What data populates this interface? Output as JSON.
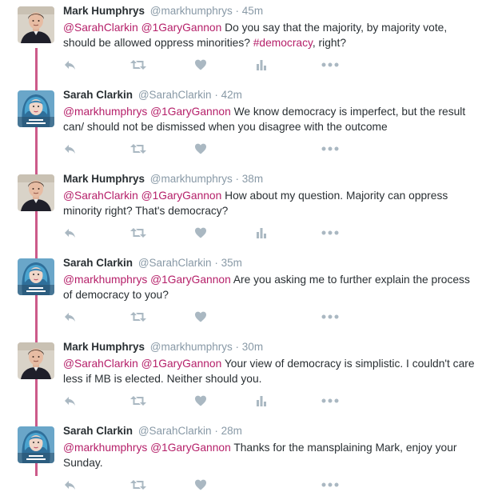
{
  "colors": {
    "link": "#b51f69",
    "muted": "#8899a6",
    "thread_line": "#cc5a8a",
    "icon": "#aab8c2"
  },
  "tweets": [
    {
      "name": "Mark Humphrys",
      "handle": "@markhumphrys",
      "time": "45m",
      "avatar": "mark-avatar",
      "mentions": "@SarahClarkin @1GaryGannon",
      "text": "  Do you say that the majority, by majority vote, should be allowed oppress minorities? ",
      "hashtag": "#democracy",
      "tail": ", right?"
    },
    {
      "name": "Sarah Clarkin",
      "handle": "@SarahClarkin",
      "time": "42m",
      "avatar": "sarah-avatar",
      "mentions": "@markhumphrys @1GaryGannon",
      "text": " We know democracy is imperfect, but the result can/ should not be dismissed when you disagree with the outcome"
    },
    {
      "name": "Mark Humphrys",
      "handle": "@markhumphrys",
      "time": "38m",
      "avatar": "mark-avatar",
      "mentions": "@SarahClarkin @1GaryGannon",
      "text": "  How about my question. Majority can oppress minority right? That's democracy?"
    },
    {
      "name": "Sarah Clarkin",
      "handle": "@SarahClarkin",
      "time": "35m",
      "avatar": "sarah-avatar",
      "mentions": "@markhumphrys @1GaryGannon",
      "text": " Are you asking me to further explain the process of democracy to you?"
    },
    {
      "name": "Mark Humphrys",
      "handle": "@markhumphrys",
      "time": "30m",
      "avatar": "mark-avatar",
      "mentions": "@SarahClarkin @1GaryGannon",
      "text": "  Your view of democracy is simplistic. I couldn't care less if MB is elected. Neither should you."
    },
    {
      "name": "Sarah Clarkin",
      "handle": "@SarahClarkin",
      "time": "28m",
      "avatar": "sarah-avatar",
      "mentions": "@markhumphrys @1GaryGannon",
      "text": " Thanks for the mansplaining Mark, enjoy your Sunday."
    }
  ]
}
